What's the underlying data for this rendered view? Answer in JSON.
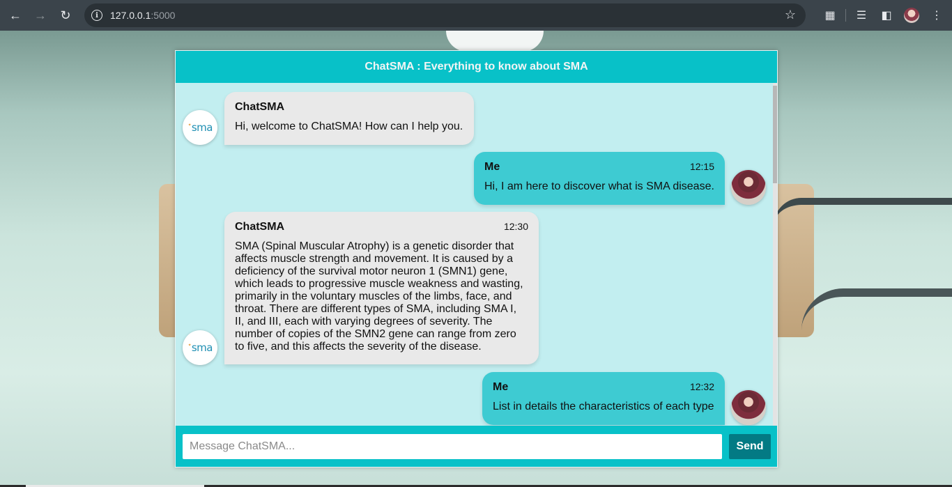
{
  "browser": {
    "url_host": "127.0.0.1",
    "url_port": ":5000"
  },
  "chat": {
    "title": "ChatSMA : Everything to know about SMA",
    "messages": [
      {
        "sender": "ChatSMA",
        "time": "",
        "text": "Hi, welcome to ChatSMA! How can I help you."
      },
      {
        "sender": "Me",
        "time": "12:15",
        "text": "Hi, I am here to discover what is SMA disease."
      },
      {
        "sender": "ChatSMA",
        "time": "12:30",
        "text": "SMA (Spinal Muscular Atrophy) is a genetic disorder that affects muscle strength and movement. It is caused by a deficiency of the survival motor neuron 1 (SMN1) gene, which leads to progressive muscle weakness and wasting, primarily in the voluntary muscles of the limbs, face, and throat. There are different types of SMA, including SMA I, II, and III, each with varying degrees of severity. The number of copies of the SMN2 gene can range from zero to five, and this affects the severity of the disease."
      },
      {
        "sender": "Me",
        "time": "12:32",
        "text": "List in details the characteristics of each type"
      }
    ],
    "bot_logo_text": "sma",
    "input_placeholder": "Message ChatSMA...",
    "send_label": "Send"
  }
}
